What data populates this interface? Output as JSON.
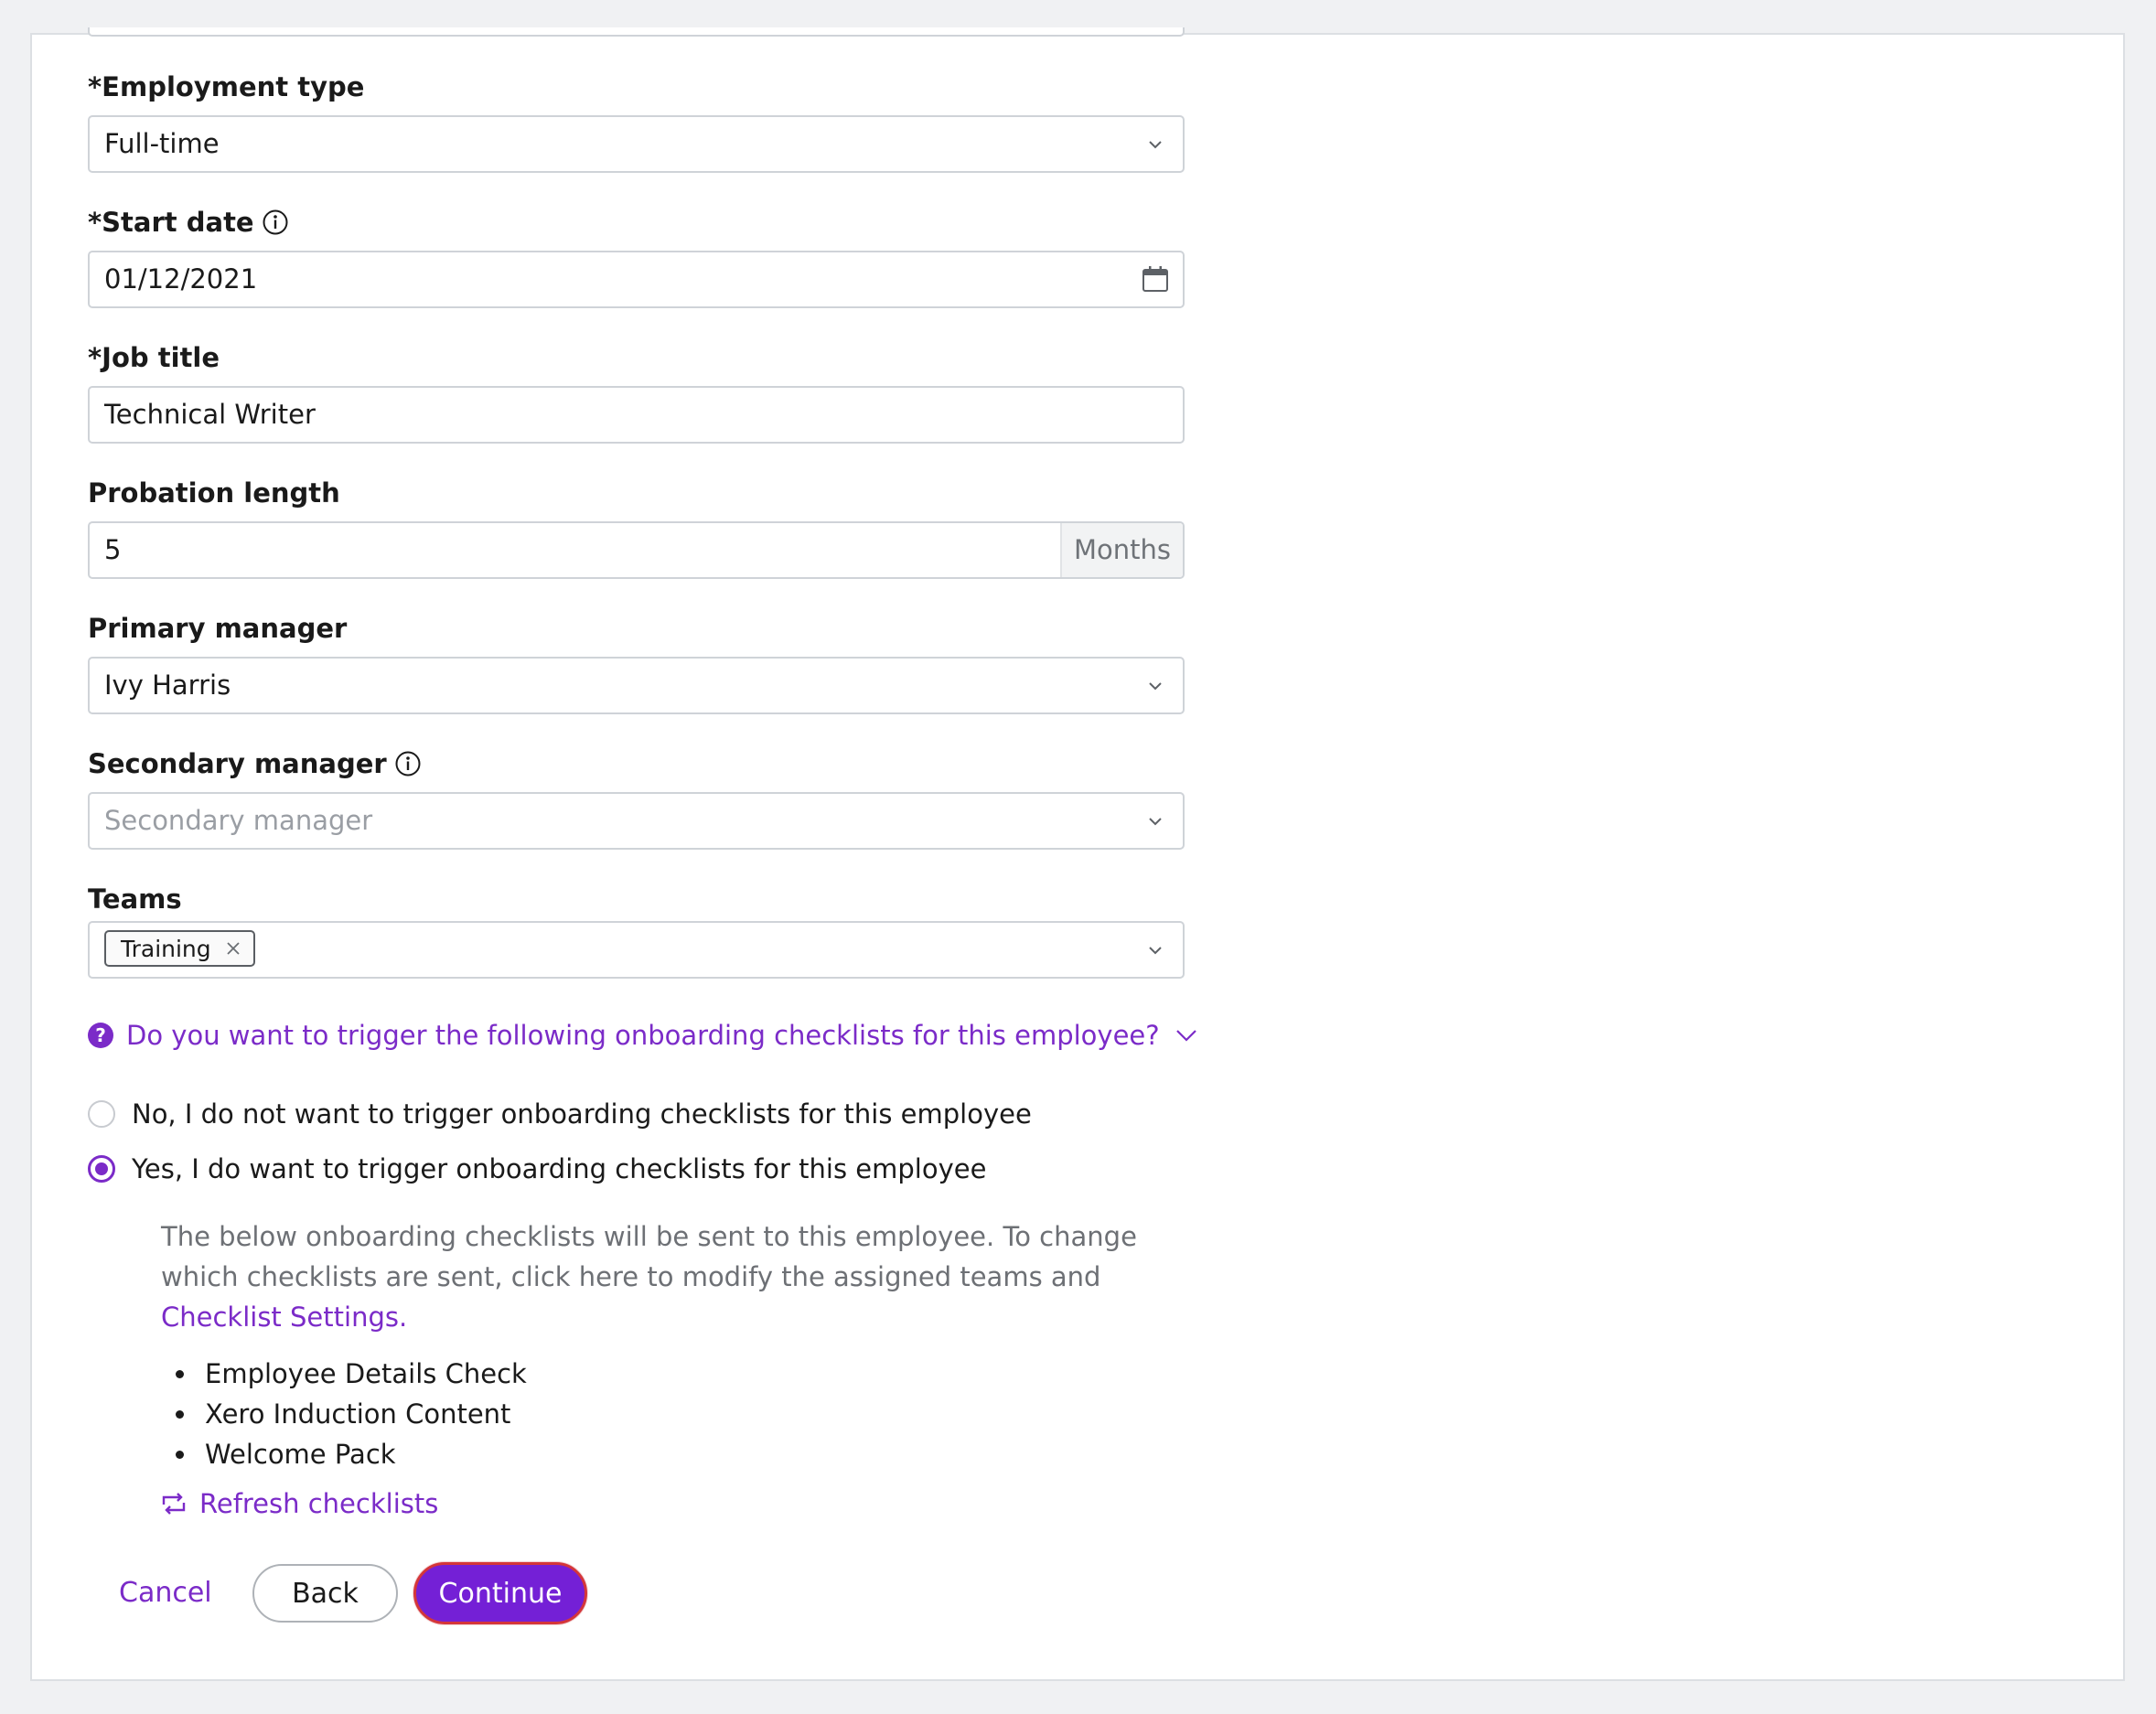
{
  "form": {
    "employment_type": {
      "label": "*Employment type",
      "value": "Full-time",
      "icon": "chevron-down-icon"
    },
    "start_date": {
      "label": "*Start date",
      "value": "01/12/2021",
      "info_icon": "info-icon",
      "icon": "calendar-icon"
    },
    "job_title": {
      "label": "*Job title",
      "value": "Technical Writer"
    },
    "probation_length": {
      "label": "Probation length",
      "value": "5",
      "suffix": "Months"
    },
    "primary_manager": {
      "label": "Primary manager",
      "value": "Ivy Harris",
      "icon": "chevron-down-icon"
    },
    "secondary_manager": {
      "label": "Secondary manager",
      "placeholder": "Secondary manager",
      "info_icon": "info-icon",
      "icon": "chevron-down-icon"
    },
    "teams": {
      "label": "Teams",
      "tags": [
        "Training"
      ],
      "icon": "chevron-down-icon"
    }
  },
  "onboarding": {
    "question": "Do you want to trigger the following onboarding checklists for this employee?",
    "question_icon_glyph": "?",
    "options": [
      {
        "label": "No, I do not want to trigger onboarding checklists for this employee",
        "selected": false
      },
      {
        "label": "Yes, I do want to trigger onboarding checklists for this employee",
        "selected": true
      }
    ],
    "description": "The below onboarding checklists will be sent to this employee. To change which checklists are sent, click here to modify the assigned teams and",
    "settings_link": "Checklist Settings.",
    "checklists": [
      "Employee Details Check",
      "Xero Induction Content",
      "Welcome Pack"
    ],
    "refresh_label": "Refresh checklists"
  },
  "actions": {
    "cancel": "Cancel",
    "back": "Back",
    "continue": "Continue"
  },
  "colors": {
    "accent": "#7420d6",
    "link": "#7b2bc8",
    "focus_ring": "#d4363a",
    "background": "#f0f1f3"
  }
}
